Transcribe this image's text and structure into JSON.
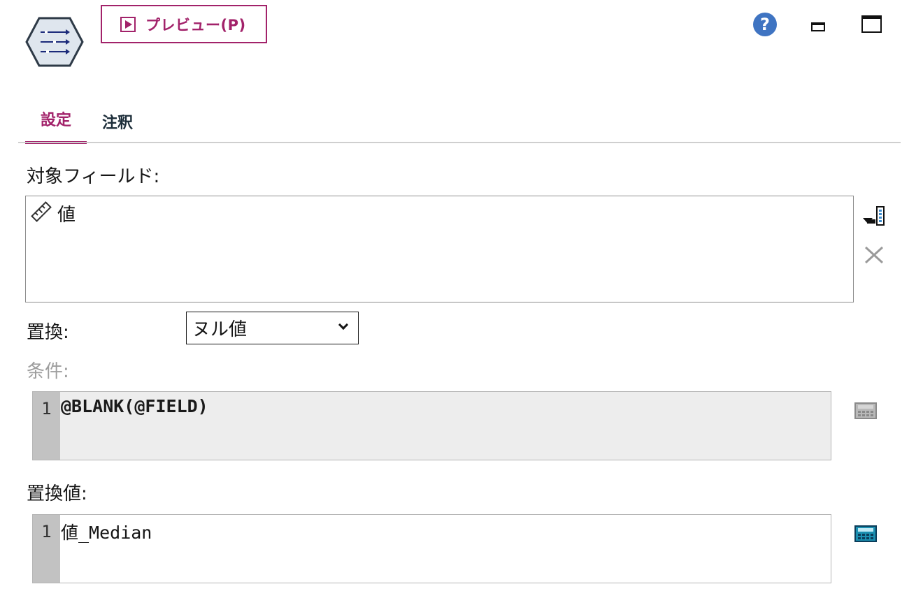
{
  "header": {
    "node_icon": "filler-node-icon",
    "preview_label": "プレビュー(P)",
    "help_icon_glyph": "?"
  },
  "tabs": [
    {
      "label": "設定",
      "active": true
    },
    {
      "label": "注釈",
      "active": false
    }
  ],
  "settings": {
    "target_fields_label": "対象フィールド:",
    "target_fields": [
      {
        "icon": "continuous-field-icon",
        "name": "値"
      }
    ],
    "replace_label": "置換:",
    "replace_value": "ヌル値",
    "condition_label": "条件:",
    "condition_line_number": "1",
    "condition_code": "@BLANK(@FIELD)",
    "replace_with_label": "置換値:",
    "replace_with_line_number": "1",
    "replace_with_code": "値_Median"
  },
  "colors": {
    "accent": "#a2226a",
    "help_blue": "#3f74c2",
    "editor_disabled_bg": "#ededed",
    "gutter": "#c2c2c2"
  }
}
